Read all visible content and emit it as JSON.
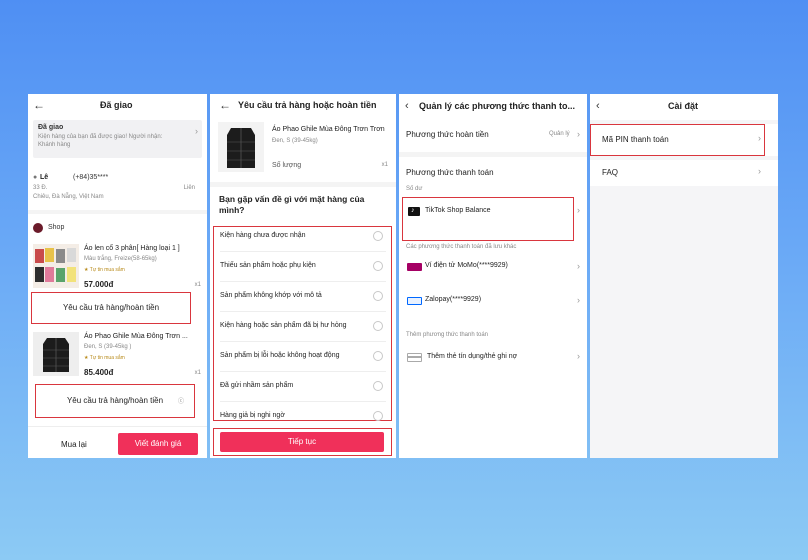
{
  "panel1": {
    "title": "Đã giao",
    "status_title": "Đã giao",
    "status_desc_1": "Kiện hàng của bạn đã được giao! Người nhận:",
    "status_desc_2": "Khánh hàng",
    "address_name": "Lê",
    "address_phone": "(+84)35****",
    "address_line1": "33 Đ.",
    "address_line2": "Chiêu, Đà Nẵng, Việt Nam",
    "address_link": "Liên",
    "shop_label": "Shop",
    "product1": {
      "name": "Áo len cổ 3 phân[ Hàng loại 1 ]",
      "variant": "Màu trắng, Freize(58-65kg)",
      "tag": "Tự tin mua sắm",
      "price": "57.000đ",
      "qty": "x1"
    },
    "return_btn_1": "Yêu cầu trả hàng/hoàn tiền",
    "product2": {
      "name": "Áo Phao Ghile Mùa Đông Trơn ...",
      "variant": "Đen, S (39-45kg )",
      "tag": "Tự tin mua sắm",
      "price": "85.400đ",
      "qty": "x1"
    },
    "return_btn_2": "Yêu cầu trả hàng/hoàn tiền",
    "return_btn_2_icon": "ⓒ",
    "buy_again": "Mua lại",
    "write_review": "Viết đánh giá"
  },
  "panel2": {
    "title": "Yêu cầu trả hàng hoặc hoàn tiền",
    "product_name_1": "Áo Phao Ghile Mùa Đông Trơn Trơn",
    "product_name_2": "Đen, S (39-45kg)",
    "qty_label": "Số lượng",
    "qty_value": "x1",
    "question": "Bạn gặp vấn đề gì với mặt hàng của mình?",
    "reasons": [
      "Kiện hàng chưa được nhận",
      "Thiếu sản phẩm hoặc phụ kiện",
      "Sản phẩm không khớp với mô tả",
      "Kiện hàng hoặc sản phẩm đã bị hư hỏng",
      "Sản phẩm bị lỗi hoặc không hoạt động",
      "Đã gửi nhầm sản phẩm",
      "Hàng giả bị nghi ngờ"
    ],
    "continue_btn": "Tiếp tục"
  },
  "panel3": {
    "title": "Quản lý các phương thức thanh to...",
    "refund_method_label": "Phương thức hoàn tiền",
    "refund_method_value": "Quản lý",
    "payment_method_label": "Phương thức thanh toán",
    "balance_label": "Số dư",
    "tiktok_balance": "TikTok Shop Balance",
    "saved_methods_label": "Các phương thức thanh toán đã lưu khác",
    "momo": "Ví điện tử MoMo(****9929)",
    "zalopay": "Zalopay(****9929)",
    "add_method_label": "Thêm phương thức thanh toán",
    "add_card": "Thêm thẻ tín dụng/thẻ ghi nợ"
  },
  "panel4": {
    "title": "Cài đặt",
    "pin": "Mã PIN thanh toán",
    "faq": "FAQ"
  },
  "colors": {
    "accent": "#f0305a",
    "highlight": "#d9363e",
    "momo": "#a50064",
    "zalopay": "#0068ff"
  }
}
